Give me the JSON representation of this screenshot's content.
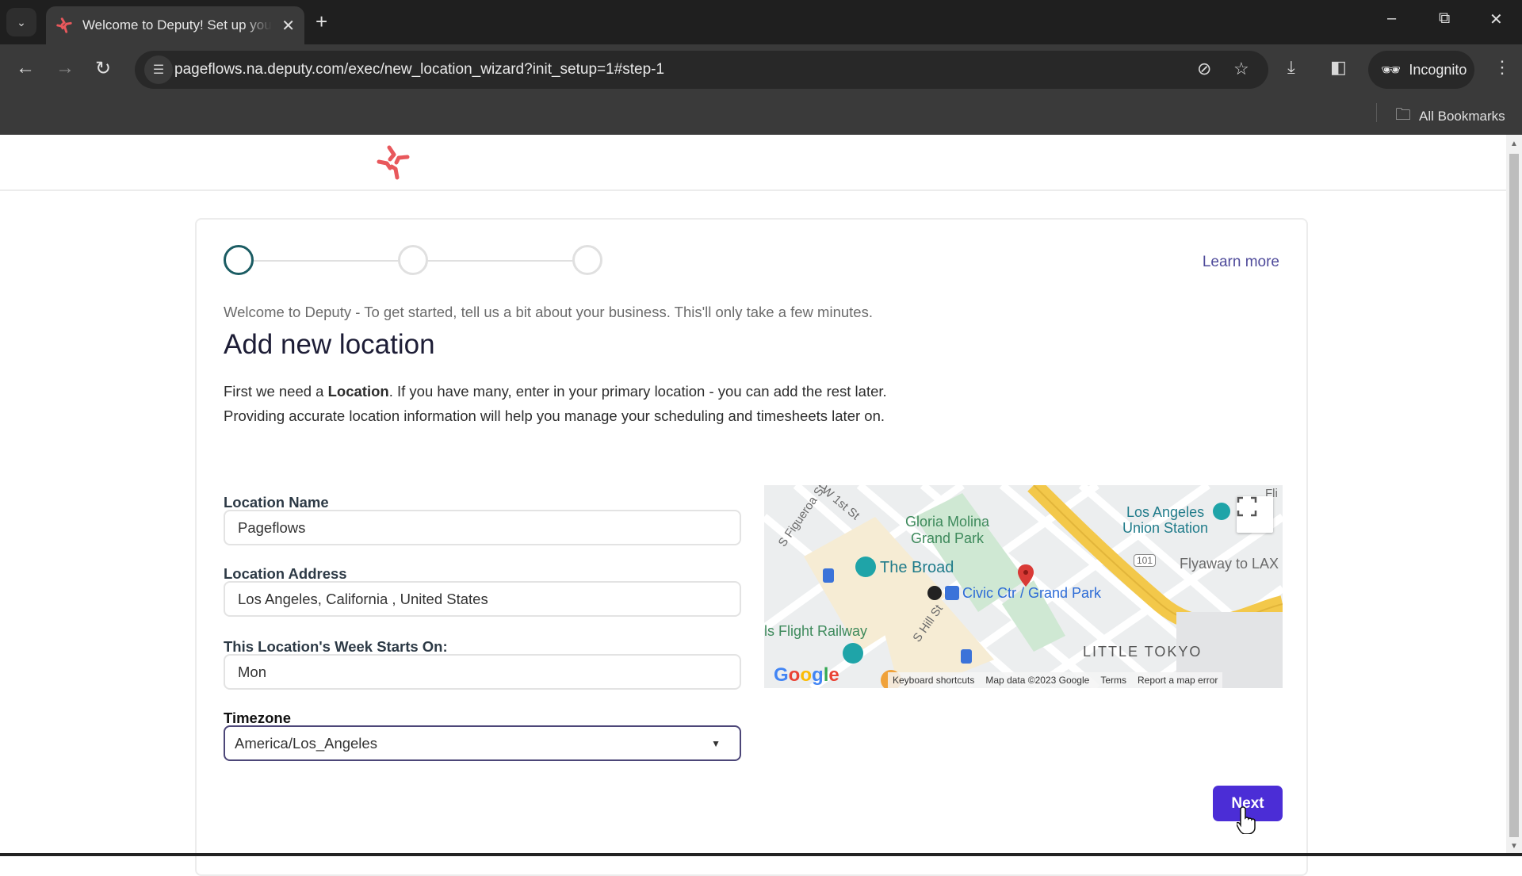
{
  "browser": {
    "tab_title": "Welcome to Deputy! Set up your",
    "url": "pageflows.na.deputy.com/exec/new_location_wizard?init_setup=1#step-1",
    "incognito_label": "Incognito",
    "bookmarks_label": "All Bookmarks",
    "icons": {
      "tab_list": "chevron-down-icon",
      "tab_close": "close-icon",
      "new_tab": "plus-icon",
      "back": "arrow-left-icon",
      "forward": "arrow-right-icon",
      "reload": "reload-icon",
      "site_info": "tune-icon",
      "tracking": "eye-off-icon",
      "bookmark": "star-icon",
      "download": "download-icon",
      "side_panel": "side-panel-icon",
      "incognito": "incognito-icon",
      "menu": "kebab-menu-icon",
      "folder": "folder-icon"
    }
  },
  "page": {
    "brand_color": "#e8585c",
    "stepper": {
      "total_steps": 3,
      "current_step": 1,
      "active_color": "#1b5c63"
    },
    "learn_more": "Learn more",
    "welcome": "Welcome to Deputy - To get started, tell us a bit about your business. This'll only take a few minutes.",
    "title": "Add new location",
    "intro": {
      "before_bold": "First we need a ",
      "bold": "Location",
      "after_bold": ". If you have many, enter in your primary location - you can add the rest later. Providing accurate location information will help you manage your scheduling and timesheets later on."
    },
    "form": {
      "location_name": {
        "label": "Location Name",
        "value": "Pageflows"
      },
      "location_address": {
        "label": "Location Address",
        "value": "Los Angeles,  California , United States"
      },
      "week_start": {
        "label": "This Location's Week Starts On:",
        "value": "Mon"
      },
      "timezone": {
        "label": "Timezone",
        "value": "America/Los_Angeles"
      }
    },
    "map": {
      "labels": {
        "figueroa": "S Figueroa St",
        "first_st": "W 1st St",
        "park": "Gloria Molina\nGrand Park",
        "park_line1": "Gloria Molina",
        "park_line2": "Grand Park",
        "broad": "The Broad",
        "civic": "Civic Ctr / Grand Park",
        "union_line1": "Los Angeles",
        "union_line2": "Union Station",
        "flyaway": "Flyaway to LAX",
        "hwy": "101",
        "angels": "ls Flight Railway",
        "hill": "S Hill St",
        "little_tokyo": "LITTLE TOKYO",
        "corner": "Fli"
      },
      "google": "Google",
      "footer": {
        "shortcuts": "Keyboard shortcuts",
        "data": "Map data ©2023 Google",
        "terms": "Terms",
        "report": "Report a map error"
      }
    },
    "next_button": "Next",
    "accent_color": "#4b2dd6"
  }
}
